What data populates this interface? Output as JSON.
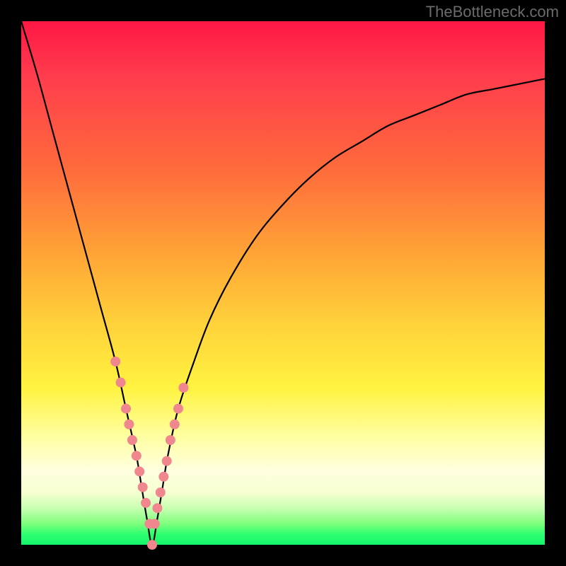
{
  "watermark": "TheBottleneck.com",
  "colors": {
    "background_frame": "#000000",
    "curve": "#000000",
    "marker": "#f0868e",
    "gradient_top": "#ff1744",
    "gradient_bottom": "#14f56a"
  },
  "chart_data": {
    "type": "line",
    "title": "",
    "xlabel": "",
    "ylabel": "",
    "xlim": [
      0,
      100
    ],
    "ylim": [
      0,
      100
    ],
    "x_min_at": 25,
    "series": [
      {
        "name": "bottleneck-curve",
        "x": [
          0,
          3,
          6,
          9,
          12,
          15,
          18,
          20,
          22,
          23,
          24,
          25,
          26,
          27,
          28,
          30,
          33,
          36,
          40,
          45,
          50,
          55,
          60,
          65,
          70,
          75,
          80,
          85,
          90,
          95,
          100
        ],
        "values": [
          100,
          90,
          79,
          68,
          57,
          46,
          35,
          26,
          17,
          11,
          5,
          0,
          5,
          11,
          17,
          26,
          35,
          43,
          51,
          59,
          65,
          70,
          74,
          77,
          80,
          82,
          84,
          86,
          87,
          88,
          89
        ]
      }
    ],
    "markers": {
      "name": "highlight-points",
      "comment": "pink dots clustered near the V minimum on both arms",
      "x": [
        18,
        19,
        20,
        20.6,
        21.2,
        22,
        22.6,
        23.2,
        23.8,
        24.5,
        25,
        25.5,
        26,
        26.6,
        27.2,
        27.8,
        28.5,
        29.3,
        30,
        31
      ],
      "values": [
        35,
        31,
        26,
        23,
        20,
        17,
        14,
        11,
        8,
        4,
        0,
        4,
        7,
        10,
        13,
        16,
        20,
        23,
        26,
        30
      ]
    }
  }
}
